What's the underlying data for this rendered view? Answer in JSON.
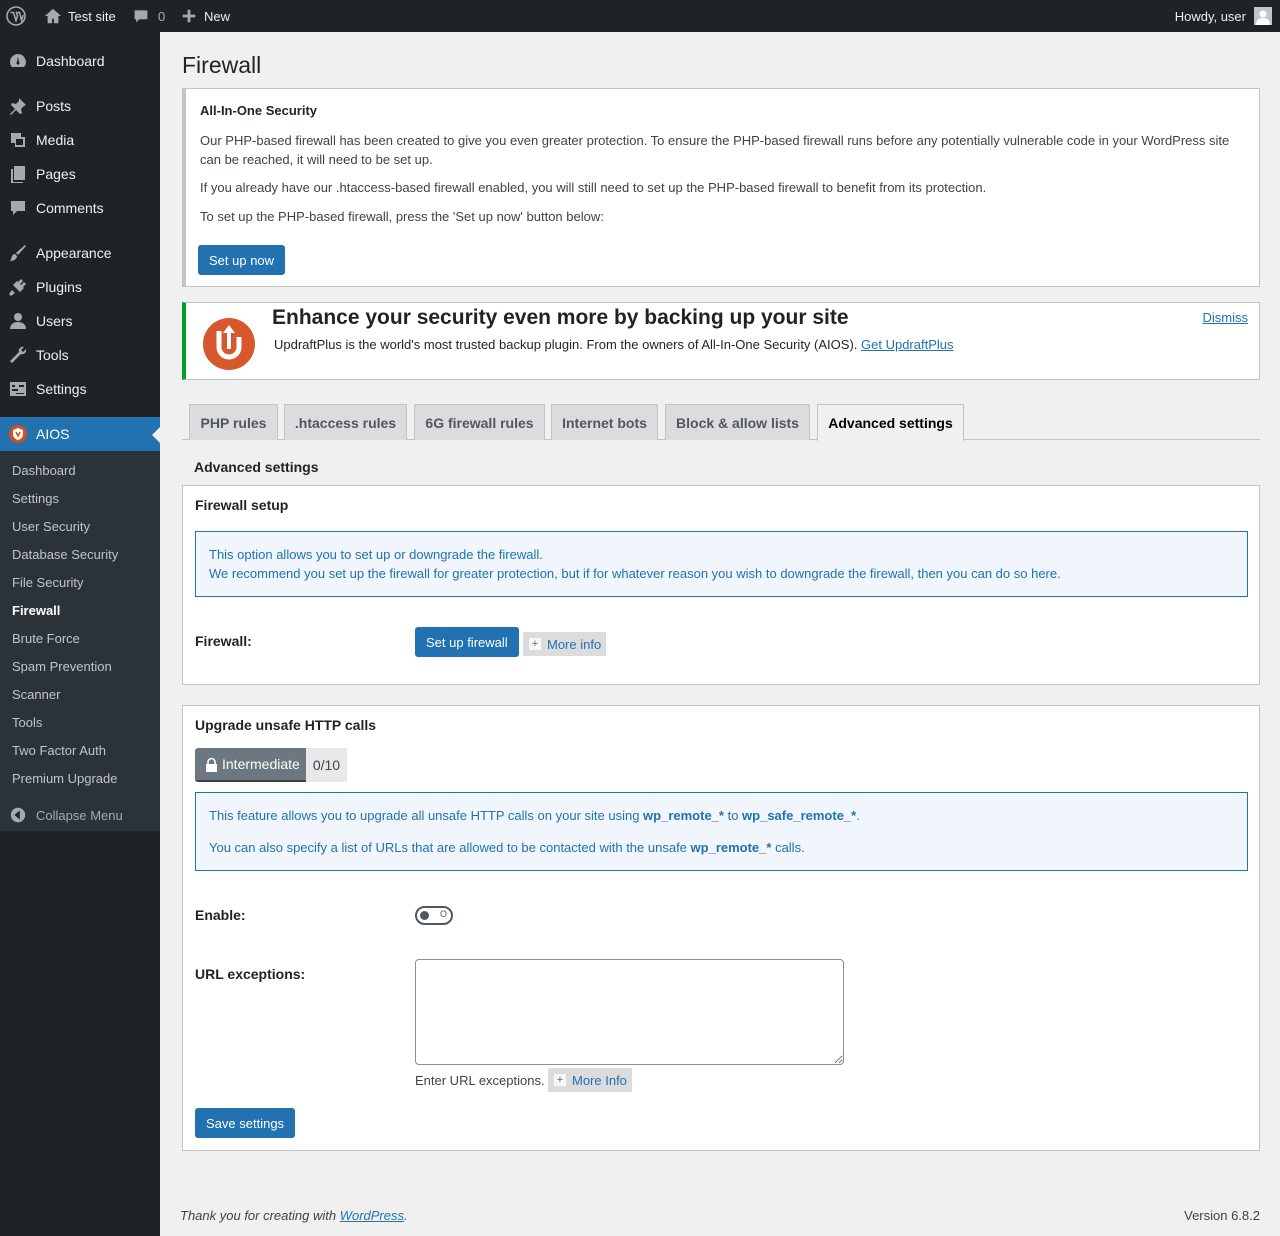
{
  "adminbar": {
    "site_name": "Test site",
    "comments_count": "0",
    "new_label": "New",
    "howdy": "Howdy, user"
  },
  "sidebar": {
    "items": [
      {
        "label": "Dashboard",
        "icon": "dashboard-icon"
      },
      {
        "label": "Posts",
        "icon": "pin-icon"
      },
      {
        "label": "Media",
        "icon": "media-icon"
      },
      {
        "label": "Pages",
        "icon": "pages-icon"
      },
      {
        "label": "Comments",
        "icon": "comment-icon"
      },
      {
        "label": "Appearance",
        "icon": "brush-icon"
      },
      {
        "label": "Plugins",
        "icon": "plug-icon"
      },
      {
        "label": "Users",
        "icon": "user-icon"
      },
      {
        "label": "Tools",
        "icon": "wrench-icon"
      },
      {
        "label": "Settings",
        "icon": "settings-icon"
      },
      {
        "label": "AIOS",
        "icon": "aios-shield-icon"
      }
    ],
    "submenu": [
      "Dashboard",
      "Settings",
      "User Security",
      "Database Security",
      "File Security",
      "Firewall",
      "Brute Force",
      "Spam Prevention",
      "Scanner",
      "Tools",
      "Two Factor Auth",
      "Premium Upgrade"
    ],
    "collapse_label": "Collapse Menu"
  },
  "page": {
    "title": "Firewall"
  },
  "aios_notice": {
    "heading": "All-In-One Security",
    "p1": "Our PHP-based firewall has been created to give you even greater protection. To ensure the PHP-based firewall runs before any potentially vulnerable code in your WordPress site can be reached, it will need to be set up.",
    "p2": "If you already have our .htaccess-based firewall enabled, you will still need to set up the PHP-based firewall to benefit from its protection.",
    "p3": "To set up the PHP-based firewall, press the 'Set up now' button below:",
    "button": "Set up now"
  },
  "updraft_notice": {
    "heading": "Enhance your security even more by backing up your site",
    "text": "UpdraftPlus is the world's most trusted backup plugin. From the owners of All-In-One Security (AIOS).",
    "link": "Get UpdraftPlus",
    "dismiss": "Dismiss"
  },
  "tabs": [
    "PHP rules",
    ".htaccess rules",
    "6G firewall rules",
    "Internet bots",
    "Block & allow lists",
    "Advanced settings"
  ],
  "section_title": "Advanced settings",
  "firewall_setup": {
    "title": "Firewall setup",
    "info_line1": "This option allows you to set up or downgrade the firewall.",
    "info_line2": "We recommend you set up the firewall for greater protection, but if for whatever reason you wish to downgrade the firewall, then you can do so here.",
    "label": "Firewall:",
    "button": "Set up firewall",
    "more_info": "More info"
  },
  "upgrade_http": {
    "title": "Upgrade unsafe HTTP calls",
    "badge_label": "Intermediate",
    "badge_score": "0/10",
    "info1_a": "This feature allows you to upgrade all unsafe HTTP calls on your site using ",
    "info1_code1": "wp_remote_*",
    "info1_b": " to ",
    "info1_code2": "wp_safe_remote_*",
    "info1_c": ".",
    "info2_a": "You can also specify a list of URLs that are allowed to be contacted with the unsafe ",
    "info2_code": "wp_remote_*",
    "info2_b": " calls.",
    "enable_label": "Enable:",
    "toggle_text": "O",
    "url_label": "URL exceptions:",
    "url_value": "",
    "url_help": "Enter URL exceptions.",
    "more_info": "More Info",
    "save": "Save settings"
  },
  "footer": {
    "thanks": "Thank you for creating with ",
    "wp_link": "WordPress",
    "period": ".",
    "version": "Version 6.8.2"
  }
}
